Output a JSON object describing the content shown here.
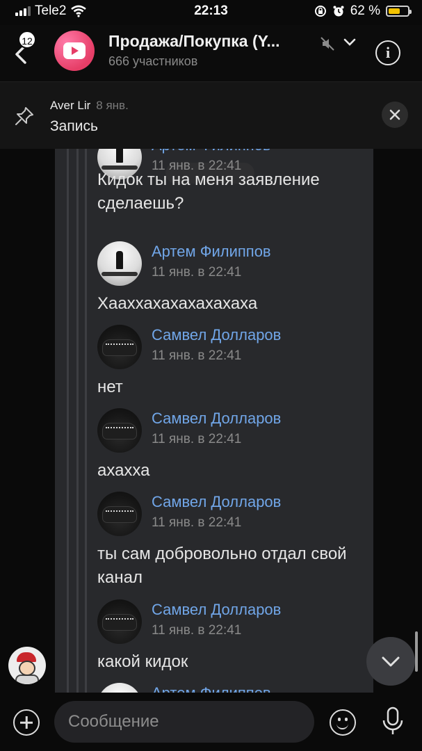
{
  "status": {
    "carrier": "Tele2",
    "time": "22:13",
    "battery": "62 %",
    "battery_level": 0.62
  },
  "header": {
    "badge": "12",
    "title": "Продажа/Покупка (Y...",
    "subtitle": "666 участников"
  },
  "pinned": {
    "author": "Aver Lir",
    "date": "8 янв.",
    "text": "Запись"
  },
  "messages": [
    {
      "author": "Артем Филиппов",
      "time": "11 янв. в 22:41",
      "text": "Кидок ты на меня заявление сделаешь?",
      "avatar": "person-avatar"
    },
    {
      "author": "Артем Филиппов",
      "time": "11 янв. в 22:41",
      "text": "Хааххахахахахахаха",
      "avatar": "person-avatar"
    },
    {
      "author": "Самвел Долларов",
      "time": "11 янв. в 22:41",
      "text": "нет",
      "avatar": "car-avatar"
    },
    {
      "author": "Самвел Долларов",
      "time": "11 янв. в 22:41",
      "text": "ахахха",
      "avatar": "car-avatar"
    },
    {
      "author": "Самвел Долларов",
      "time": "11 янв. в 22:41",
      "text": "ты сам добровольно отдал свой канал",
      "avatar": "car-avatar"
    },
    {
      "author": "Самвел Долларов",
      "time": "11 янв. в 22:41",
      "text": "какой кидок",
      "avatar": "car-avatar"
    },
    {
      "author": "Артем Филиппов",
      "time": "",
      "text": "",
      "avatar": "person-avatar"
    }
  ],
  "composer": {
    "placeholder": "Сообщение"
  },
  "colors": {
    "accent_name": "#71a6e8",
    "bubble": "#28292c",
    "battery": "#f2c200"
  }
}
